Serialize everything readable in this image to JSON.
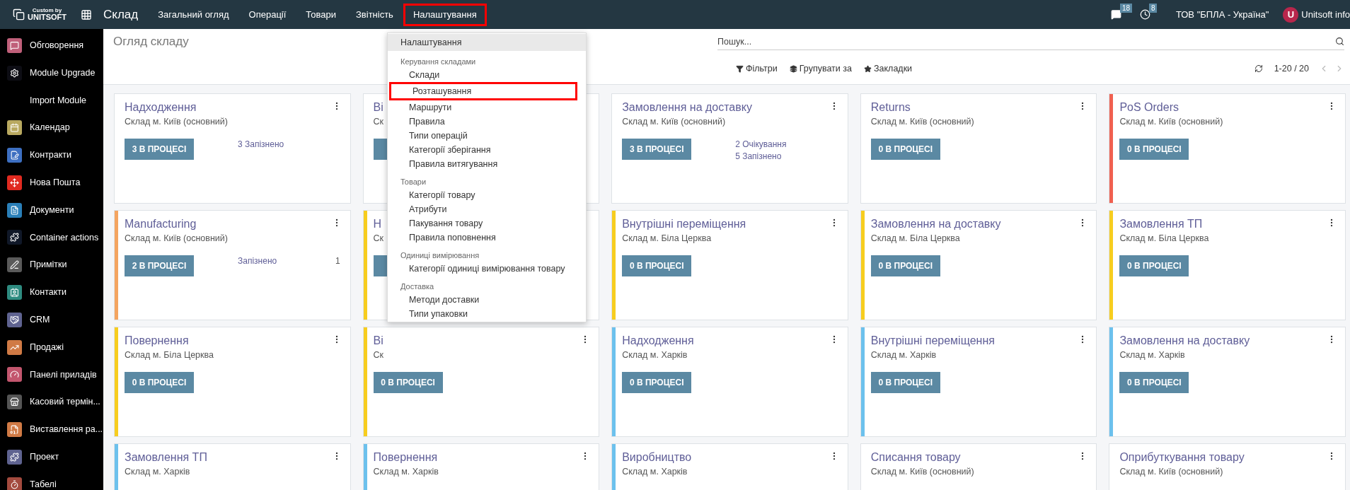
{
  "topbar": {
    "logo_top": "Custom by",
    "logo_bottom": "UNITSOFT",
    "app_title": "Склад",
    "menu": [
      {
        "label": "Загальний огляд",
        "highlighted": false
      },
      {
        "label": "Операції",
        "highlighted": false
      },
      {
        "label": "Товари",
        "highlighted": false
      },
      {
        "label": "Звітність",
        "highlighted": false
      },
      {
        "label": "Налаштування",
        "highlighted": true
      }
    ],
    "messages_count": "18",
    "activities_count": "8",
    "company": "ТОВ \"БПЛА - Україна\"",
    "avatar_letter": "U",
    "user": "Unitsoft info"
  },
  "sidebar": {
    "items": [
      {
        "label": "Обговорення",
        "color": "#c0607a"
      },
      {
        "label": "Module Upgrade",
        "color": "#0d0d14"
      },
      {
        "label": "Import Module"
      },
      {
        "label": "Календар",
        "color": "#b9a960"
      },
      {
        "label": "Контракти",
        "color": "#3d6fc1"
      },
      {
        "label": "Нова Пошта",
        "color": "#e02a20"
      },
      {
        "label": "Документи",
        "color": "#2a7fb8"
      },
      {
        "label": "Container actions",
        "color": "#101828"
      },
      {
        "label": "Примітки",
        "color": "#5a5a5a"
      },
      {
        "label": "Контакти",
        "color": "#2e8b80"
      },
      {
        "label": "CRM",
        "color": "#5f6390"
      },
      {
        "label": "Продажі",
        "color": "#d07a45"
      },
      {
        "label": "Панелі приладів",
        "color": "#c3566e"
      },
      {
        "label": "Касовий термін...",
        "color": "#555555"
      },
      {
        "label": "Виставлення ра...",
        "color": "#d07a45"
      },
      {
        "label": "Проект",
        "color": "#5f6390"
      },
      {
        "label": "Табелі",
        "color": "#a34a3e"
      }
    ]
  },
  "control_panel": {
    "breadcrumb": "Огляд складу",
    "search": {
      "placeholder": "Пошук..."
    },
    "filters": [
      "Фільтри",
      "Групувати за",
      "Закладки"
    ],
    "pager": "1-20 / 20"
  },
  "dropdown": {
    "items": [
      {
        "kind": "item",
        "label": "Налаштування",
        "active": true,
        "highlighted": false
      },
      {
        "kind": "header",
        "label": "Керування складами"
      },
      {
        "kind": "subitem",
        "label": "Склади",
        "active": false,
        "highlighted": false
      },
      {
        "kind": "subitem",
        "label": "Розташування",
        "active": false,
        "highlighted": true
      },
      {
        "kind": "subitem",
        "label": "Маршрути",
        "active": false,
        "highlighted": false
      },
      {
        "kind": "subitem",
        "label": "Правила",
        "active": false,
        "highlighted": false
      },
      {
        "kind": "subitem",
        "label": "Типи операцій",
        "active": false,
        "highlighted": false
      },
      {
        "kind": "subitem",
        "label": "Категорії зберігання",
        "active": false,
        "highlighted": false
      },
      {
        "kind": "subitem",
        "label": "Правила витягування",
        "active": false,
        "highlighted": false
      },
      {
        "kind": "header",
        "label": "Товари"
      },
      {
        "kind": "subitem",
        "label": "Категорії товару",
        "active": false,
        "highlighted": false
      },
      {
        "kind": "subitem",
        "label": "Атрибути",
        "active": false,
        "highlighted": false
      },
      {
        "kind": "subitem",
        "label": "Пакування товару",
        "active": false,
        "highlighted": false
      },
      {
        "kind": "subitem",
        "label": "Правила поповнення",
        "active": false,
        "highlighted": false
      },
      {
        "kind": "header",
        "label": "Одиниці вимірювання"
      },
      {
        "kind": "subitem",
        "label": "Категорії одиниці вимірювання товару",
        "active": false,
        "highlighted": false
      },
      {
        "kind": "header",
        "label": "Доставка"
      },
      {
        "kind": "subitem",
        "label": "Методи доставки",
        "active": false,
        "highlighted": false
      },
      {
        "kind": "subitem",
        "label": "Типи упаковки",
        "active": false,
        "highlighted": false
      }
    ]
  },
  "cards": [
    {
      "title": "Надходження",
      "warehouse": "Склад м. Київ (основний)",
      "button": "3 В ПРОЦЕСІ",
      "stats": [
        {
          "text": "3 Запізнено"
        }
      ]
    },
    {
      "title": "Ві",
      "warehouse": "Ск",
      "has_button": true
    },
    {
      "title": "Замовлення на доставку",
      "warehouse": "Склад м. Київ (основний)",
      "button": "3 В ПРОЦЕСІ",
      "stats": [
        {
          "text": "2 Очікування"
        },
        {
          "text": "5 Запізнено"
        }
      ]
    },
    {
      "title": "Returns",
      "warehouse": "Склад м. Київ (основний)",
      "button": "0 В ПРОЦЕСІ"
    },
    {
      "title": "PoS Orders",
      "warehouse": "Склад м. Київ (основний)",
      "button": "0 В ПРОЦЕСІ",
      "color": "#f06050"
    },
    {
      "title": "Manufacturing",
      "warehouse": "Склад м. Київ (основний)",
      "button": "2 В ПРОЦЕСІ",
      "color": "#f4a460",
      "stats": [
        {
          "text": "Запізнено",
          "count": "1"
        }
      ]
    },
    {
      "title": "Н",
      "warehouse": "Ск",
      "has_button": true,
      "color": "#f7cd1f"
    },
    {
      "title": "Внутрішні переміщення",
      "warehouse": "Склад м. Біла Церква",
      "button": "0 В ПРОЦЕСІ",
      "color": "#f7cd1f"
    },
    {
      "title": "Замовлення на доставку",
      "warehouse": "Склад м. Біла Церква",
      "button": "0 В ПРОЦЕСІ",
      "color": "#f7cd1f"
    },
    {
      "title": "Замовлення ТП",
      "warehouse": "Склад м. Біла Церква",
      "button": "0 В ПРОЦЕСІ",
      "color": "#f7cd1f"
    },
    {
      "title": "Повернення",
      "warehouse": "Склад м. Біла Церква",
      "button": "0 В ПРОЦЕСІ",
      "color": "#f7cd1f"
    },
    {
      "title": "Ві",
      "warehouse": "Ск",
      "button": "0 В ПРОЦЕСІ",
      "color": "#f7cd1f"
    },
    {
      "title": "Надходження",
      "warehouse": "Склад м. Харків",
      "button": "0 В ПРОЦЕСІ",
      "color": "#6cc1ed"
    },
    {
      "title": "Внутрішні переміщення",
      "warehouse": "Склад м. Харків",
      "button": "0 В ПРОЦЕСІ",
      "color": "#6cc1ed"
    },
    {
      "title": "Замовлення на доставку",
      "warehouse": "Склад м. Харків",
      "button": "0 В ПРОЦЕСІ",
      "color": "#6cc1ed"
    },
    {
      "title": "Замовлення ТП",
      "warehouse": "Склад м. Харків",
      "color": "#6cc1ed"
    },
    {
      "title": "Повернення",
      "warehouse": "Склад м. Харків",
      "color": "#6cc1ed"
    },
    {
      "title": "Виробництво",
      "warehouse": "Склад м. Харків",
      "color": "#6cc1ed"
    },
    {
      "title": "Списання товару",
      "warehouse": "Склад м. Київ (основний)"
    },
    {
      "title": "Оприбуткування товару",
      "warehouse": "Склад м. Київ (основний)"
    }
  ]
}
